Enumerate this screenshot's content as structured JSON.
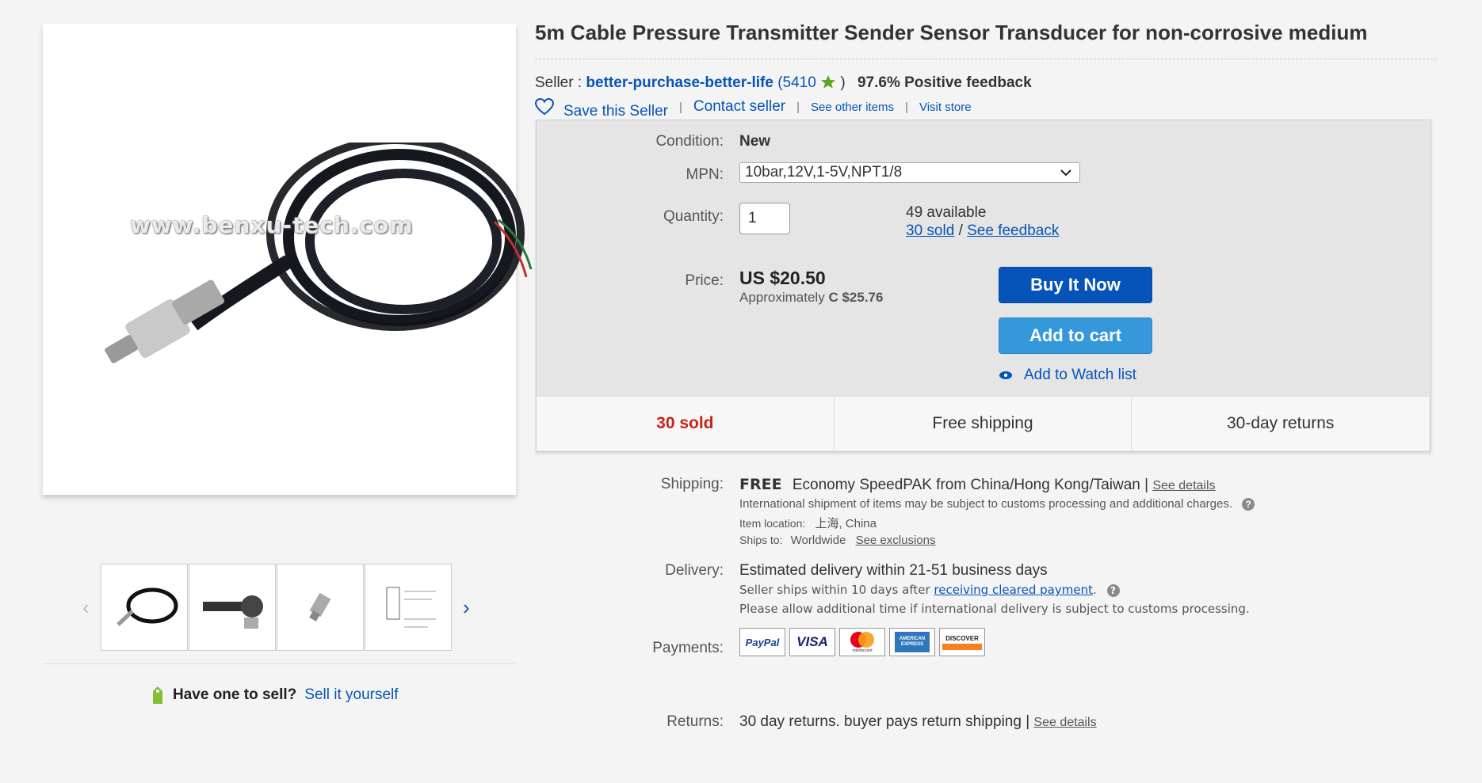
{
  "product": {
    "title": "5m Cable Pressure Transmitter Sender Sensor Transducer for non-corrosive medium",
    "image_watermark": "www.benxu-tech.com"
  },
  "seller": {
    "label": "Seller :",
    "name": "better-purchase-better-life",
    "score_open": "(5410",
    "score_close": ")",
    "feedback": "97.6% Positive feedback",
    "save_label": "Save this Seller",
    "contact_label": "Contact seller",
    "other_items_label": "See other items",
    "visit_store_label": "Visit store"
  },
  "buy_box": {
    "condition_label": "Condition:",
    "condition_value": "New",
    "mpn_label": "MPN:",
    "mpn_value": "10bar,12V,1-5V,NPT1/8",
    "quantity_label": "Quantity:",
    "quantity_value": "1",
    "available": "49 available",
    "sold_link": "30 sold",
    "slash": "/",
    "feedback_link": "See feedback",
    "price_label": "Price:",
    "price": "US $20.50",
    "approx_label": "Approximately",
    "approx_value": "C $25.76",
    "buy_now": "Buy It Now",
    "add_to_cart": "Add to cart",
    "watch": "Add to Watch list"
  },
  "stats": {
    "sold": "30 sold",
    "shipping": "Free shipping",
    "returns": "30-day returns"
  },
  "shipping": {
    "label": "Shipping:",
    "free": "FREE",
    "method": "Economy SpeedPAK from China/Hong Kong/Taiwan |",
    "details_link": "See details",
    "customs_note": "International shipment of items may be subject to customs processing and additional charges.",
    "location_label": "Item location:",
    "location_value": "上海, China",
    "ships_to_label": "Ships to:",
    "ships_to_value": "Worldwide",
    "exclusions_link": "See exclusions"
  },
  "delivery": {
    "label": "Delivery:",
    "estimate": "Estimated delivery within 21-51 business days",
    "ships_within": "Seller ships within 10 days after",
    "cleared_link": "receiving cleared payment",
    "period": ".",
    "additional": "Please allow additional time if international delivery is subject to customs processing."
  },
  "payments": {
    "label": "Payments:",
    "methods": [
      "PayPal",
      "VISA",
      "mastercard",
      "AMERICAN EXPRESS",
      "DISCOVER"
    ]
  },
  "returns": {
    "label": "Returns:",
    "text": "30 day returns. buyer pays return shipping |",
    "details_link": "See details"
  },
  "sell": {
    "question": "Have one to sell?",
    "link": "Sell it yourself"
  },
  "colors": {
    "link": "#0654ba",
    "buy_button": "#0654ba",
    "cart_button": "#3498db",
    "sold_red": "#c7241a",
    "star_green": "#5ba321"
  }
}
